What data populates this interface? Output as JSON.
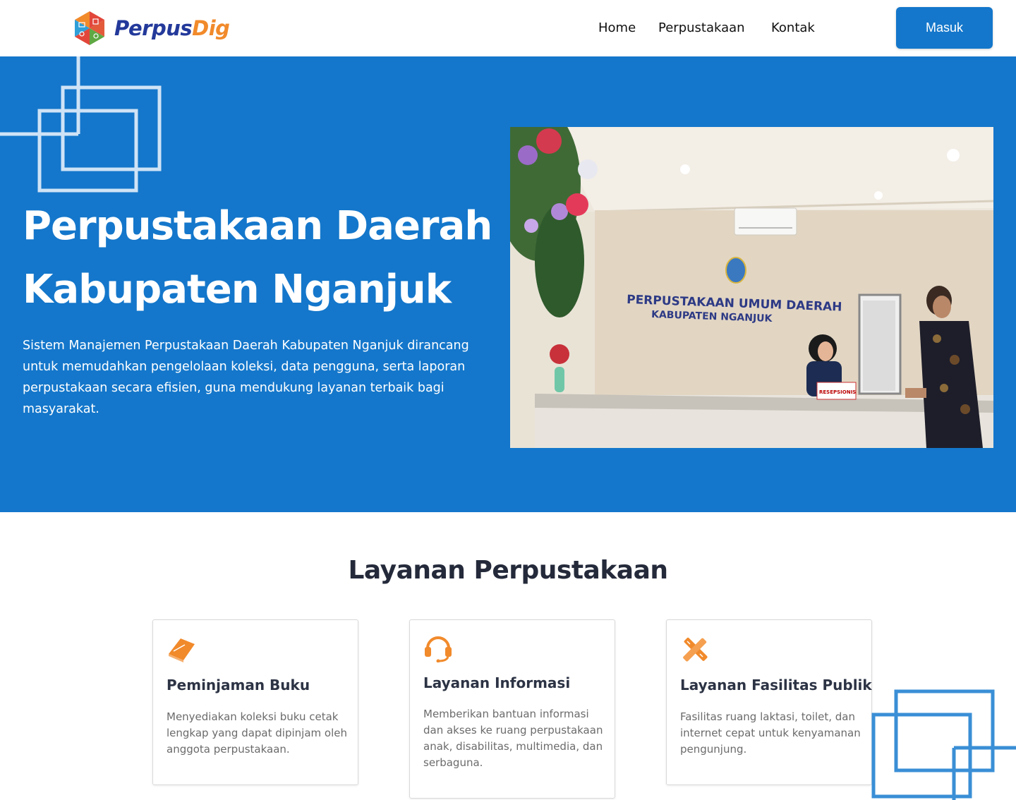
{
  "header": {
    "logo_text_primary": "Perpus",
    "logo_text_accent": "Dig",
    "nav": [
      "Home",
      "Perpustakaan",
      "Kontak"
    ],
    "login_label": "Masuk"
  },
  "hero": {
    "title_line1": "Perpustakaan Daerah",
    "title_line2": "Kabupaten Nganjuk",
    "description": "Sistem Manajemen Perpustakaan Daerah Kabupaten Nganjuk dirancang untuk memudahkan pengelolaan koleksi, data pengguna, serta laporan perpustakaan secara efisien, guna mendukung layanan terbaik bagi masyarakat.",
    "photo_sign_line1": "PERPUSTAKAAN UMUM DAERAH",
    "photo_sign_line2": "KABUPATEN NGANJUK",
    "photo_desk_label": "RESEPSIONIS"
  },
  "services": {
    "title": "Layanan Perpustakaan",
    "cards": [
      {
        "icon": "book-icon",
        "title": "Peminjaman Buku",
        "description": "Menyediakan koleksi buku cetak lengkap yang dapat dipinjam oleh anggota perpustakaan."
      },
      {
        "icon": "headset-icon",
        "title": "Layanan Informasi",
        "description": "Memberikan bantuan informasi dan akses ke ruang perpustakaan anak, disabilitas, multimedia, dan serbaguna."
      },
      {
        "icon": "tools-icon",
        "title": "Layanan Fasilitas Publik",
        "description": "Fasilitas ruang laktasi, toilet, dan internet cepat untuk kenyamanan pengunjung."
      }
    ]
  },
  "colors": {
    "primary_blue": "#1477cb",
    "accent_orange": "#f18a2b",
    "logo_navy": "#23399a"
  }
}
